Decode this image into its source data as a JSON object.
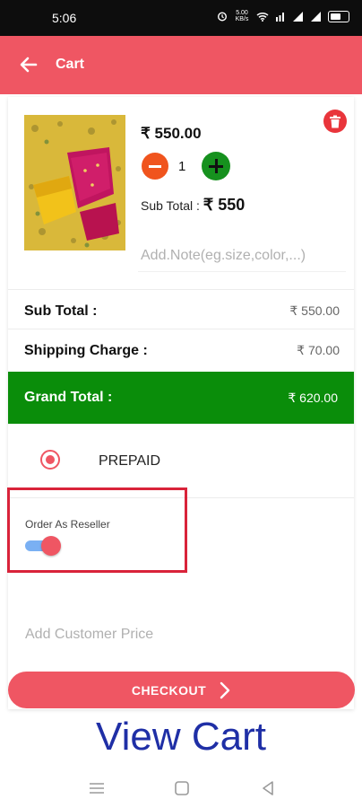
{
  "status_bar": {
    "time": "5:06",
    "network": "5.00 KB/s"
  },
  "app_bar": {
    "title": "Cart",
    "back_icon": "arrow-left-icon"
  },
  "cart_item": {
    "price": "₹ 550.00",
    "quantity": "1",
    "subtotal_label": "Sub Total : ",
    "subtotal_value": "₹ 550",
    "note_placeholder": "Add.Note(eg.size,color,...)",
    "delete_icon": "trash-icon"
  },
  "summary": {
    "subtotal_label": "Sub Total :",
    "subtotal_value": "₹ 550.00",
    "shipping_label": "Shipping Charge :",
    "shipping_value": "₹ 70.00",
    "grand_label": "Grand Total :",
    "grand_value": "₹ 620.00"
  },
  "payment": {
    "selected": "PREPAID"
  },
  "reseller": {
    "label": "Order As Reseller",
    "enabled": true
  },
  "customer_price": {
    "placeholder": "Add Customer Price"
  },
  "checkout": {
    "label": "CHECKOUT",
    "icon": "chevron-right-icon"
  },
  "caption": "View Cart",
  "colors": {
    "accent": "#ef5663",
    "grand_total_bg": "#0a8d0a",
    "caption": "#1f2fa6",
    "highlight": "#d9233a"
  }
}
